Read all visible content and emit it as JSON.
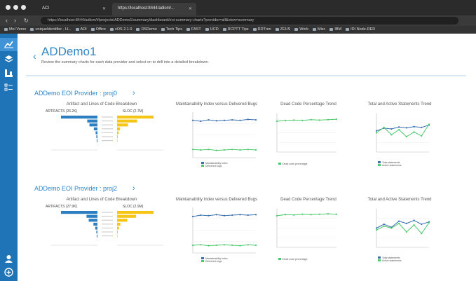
{
  "browser": {
    "tabs": [
      {
        "label": "ACI",
        "active": false
      },
      {
        "label": "https://localhost:8444/adlcm/...",
        "active": true
      }
    ],
    "url": "https://localhost:8444/adlcm/#/projects/ADDemo1/summary/dashboard/eoi-summary-charts?provider=all&view=summary",
    "bookmarks": [
      "Mel Verse",
      "uniqueIdentifier - H...",
      "ADI",
      "Office",
      "zOS 2.1.0",
      "DSDemo",
      "Tech Tips",
      "FAST",
      "UCD",
      "RCPTT Tips",
      "RDTren",
      "ZEUS",
      "Work",
      "Misc",
      "IBM",
      "IDI Node-RED"
    ]
  },
  "rail": {
    "icons": [
      "chart-icon",
      "layers-icon",
      "tree-icon",
      "list-icon",
      "user-icon",
      "add-circle-icon"
    ]
  },
  "page": {
    "title": "ADDemo1",
    "subtitle": "Review the summary charts for each data provider and select on to drill into a detailed breakdown."
  },
  "providers": [
    {
      "name": "ADDemo EOI Provider : proj0",
      "arrow": "›",
      "chart_titles": {
        "artifact": "Artifact and Lines of Code Breakdown",
        "maintainability": "Maintainability Index versus Delivered Bugs",
        "deadcode": "Dead Code Percentage Trend",
        "statements": "Total and Active Statements Trend"
      },
      "artifact_left_label": "ARTIFACTS (26.2K)",
      "artifact_right_label": "SLOC (2.7M)",
      "mi_legend": [
        "Maintainability Index",
        "Delivered bugs"
      ],
      "dead_legend": [
        "Dead code percentage"
      ],
      "stmt_legend": [
        "Total statements",
        "Active statements"
      ]
    },
    {
      "name": "ADDemo EOI Provider : proj2",
      "arrow": "›",
      "chart_titles": {
        "artifact": "Artifact and Lines of Code Breakdown",
        "maintainability": "Maintainability Index versus Delivered Bugs",
        "deadcode": "Dead Code Percentage Trend",
        "statements": "Total and Active Statements Trend"
      },
      "artifact_left_label": "ARTIFACTS (27.9K)",
      "artifact_right_label": "SLOC (2.9M)",
      "mi_legend": [
        "Maintainability Index",
        "Delivered bugs"
      ],
      "dead_legend": [
        "Dead code percentage"
      ],
      "stmt_legend": [
        "Total statements",
        "Active statements"
      ]
    }
  ],
  "colors": {
    "accent": "#2f87c9",
    "rail": "#1f73b7",
    "bar_left": "#2d7fc1",
    "bar_right": "#f5c518",
    "line_blue": "#3a6fb0",
    "line_green": "#4cc96b"
  },
  "chart_data": [
    {
      "type": "bar",
      "id": "artifact-proj0",
      "series": [
        {
          "values": [
            1.0,
            0.28,
            0.22,
            0.1,
            0.05,
            0.03,
            0.02
          ]
        },
        {
          "values": [
            1.0,
            0.55,
            0.3,
            0.08,
            0.04,
            0.02,
            0.01
          ]
        }
      ]
    },
    {
      "type": "line",
      "id": "mi-proj0",
      "series": [
        {
          "values": [
            0.82,
            0.8,
            0.83,
            0.81,
            0.82,
            0.83,
            0.82,
            0.84,
            0.83
          ]
        },
        {
          "values": [
            0.18,
            0.17,
            0.18,
            0.16,
            0.17,
            0.18,
            0.17,
            0.18,
            0.17
          ]
        }
      ]
    },
    {
      "type": "line",
      "id": "dead-proj0",
      "series": [
        {
          "values": [
            0.8,
            0.82,
            0.83,
            0.82,
            0.84,
            0.83,
            0.84,
            0.85
          ]
        }
      ]
    },
    {
      "type": "line",
      "id": "stmt-proj0",
      "series": [
        {
          "values": [
            0.55,
            0.62,
            0.6,
            0.65,
            0.63,
            0.66,
            0.64,
            0.7
          ]
        },
        {
          "values": [
            0.5,
            0.64,
            0.45,
            0.58,
            0.4,
            0.52,
            0.42,
            0.72
          ]
        }
      ]
    },
    {
      "type": "bar",
      "id": "artifact-proj2",
      "series": [
        {
          "values": [
            1.0,
            0.3,
            0.24,
            0.11,
            0.06,
            0.03,
            0.02
          ]
        },
        {
          "values": [
            1.0,
            0.52,
            0.28,
            0.09,
            0.05,
            0.02,
            0.01
          ]
        }
      ]
    },
    {
      "type": "line",
      "id": "mi-proj2",
      "series": [
        {
          "values": [
            0.8,
            0.83,
            0.82,
            0.84,
            0.82,
            0.83,
            0.84,
            0.83,
            0.84
          ]
        },
        {
          "values": [
            0.17,
            0.18,
            0.16,
            0.17,
            0.18,
            0.17,
            0.16,
            0.18,
            0.17
          ]
        }
      ]
    },
    {
      "type": "line",
      "id": "dead-proj2",
      "series": [
        {
          "values": [
            0.82,
            0.85,
            0.84,
            0.86,
            0.85,
            0.86,
            0.87,
            0.86
          ]
        }
      ]
    },
    {
      "type": "line",
      "id": "stmt-proj2",
      "series": [
        {
          "values": [
            0.5,
            0.6,
            0.52,
            0.68,
            0.62,
            0.7,
            0.6,
            0.66
          ]
        },
        {
          "values": [
            0.45,
            0.55,
            0.5,
            0.62,
            0.4,
            0.58,
            0.36,
            0.64
          ]
        }
      ]
    }
  ]
}
